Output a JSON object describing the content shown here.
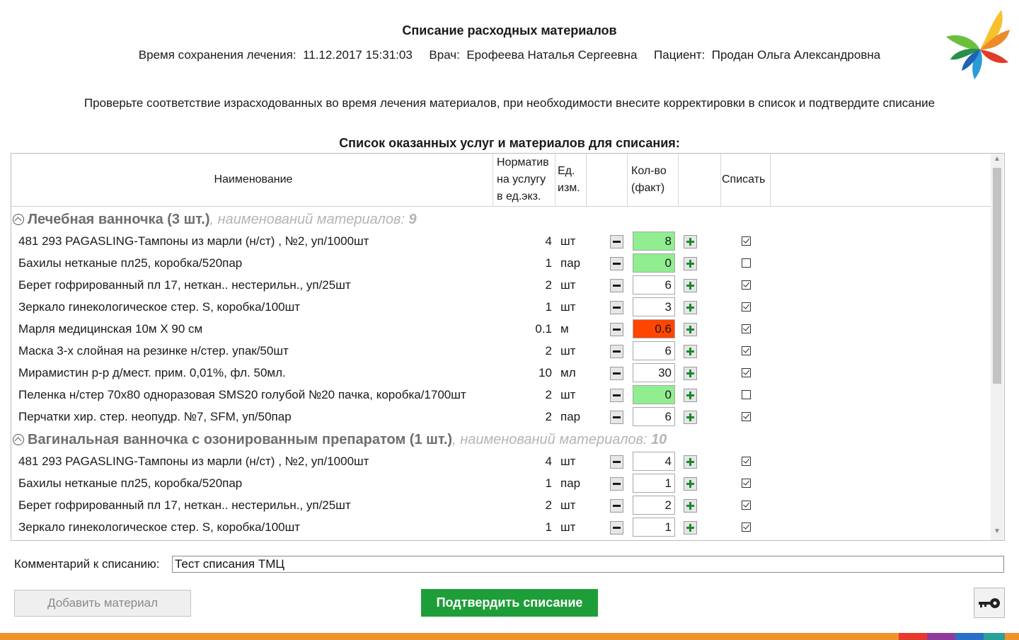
{
  "header": {
    "title": "Списание расходных материалов",
    "save_time_label": "Время сохранения лечения:",
    "save_time_value": "11.12.2017 15:31:03",
    "doctor_label": "Врач:",
    "doctor_value": "Ерофеева Наталья Сергеевна",
    "patient_label": "Пациент:",
    "patient_value": "Продан Ольга Александровна",
    "instruction": "Проверьте соответствие израсходованных во время лечения материалов, при необходимости внесите корректировки в список и подтвердите списание",
    "list_title": "Список оказанных услуг и материалов для списания:"
  },
  "table": {
    "columns": {
      "name": "Наименование",
      "norm_line1": "Норматив",
      "norm_line2": "на услугу",
      "norm_line3": "в ед.экз.",
      "unit_line1": "Ед.",
      "unit_line2": "изм.",
      "qty_line1": "Кол-во",
      "qty_line2": "(факт)",
      "writeoff": "Списать"
    },
    "groups": [
      {
        "title": "Лечебная ванночка (3 шт.)",
        "meta": ", наименований материалов: ",
        "count": "9",
        "rows": [
          {
            "name": "481 293 PAGASLING-Тампоны из марли (н/ст) , №2, уп/1000шт",
            "norm": "4",
            "unit": "шт",
            "qty": "8",
            "state": "green",
            "checked": true
          },
          {
            "name": "Бахилы нетканые пл25, коробка/520пар",
            "norm": "1",
            "unit": "пар",
            "qty": "0",
            "state": "green",
            "checked": false
          },
          {
            "name": "Берет гофрированный пл 17, неткан.. нестерильн., уп/25шт",
            "norm": "2",
            "unit": "шт",
            "qty": "6",
            "state": "normal",
            "checked": true
          },
          {
            "name": "Зеркало гинекологическое стер. S, коробка/100шт",
            "norm": "1",
            "unit": "шт",
            "qty": "3",
            "state": "normal",
            "checked": true
          },
          {
            "name": "Марля медицинская 10м Х 90 см",
            "norm": "0.1",
            "unit": "м",
            "qty": "0.6",
            "state": "red",
            "checked": true
          },
          {
            "name": "Маска 3-х слойная на резинке н/стер. упак/50шт",
            "norm": "2",
            "unit": "шт",
            "qty": "6",
            "state": "normal",
            "checked": true
          },
          {
            "name": "Мирамистин р-р д/мест. прим. 0,01%, фл. 50мл.",
            "norm": "10",
            "unit": "мл",
            "qty": "30",
            "state": "normal",
            "checked": true
          },
          {
            "name": "Пеленка н/стер 70х80 одноразовая SMS20 голубой №20 пачка, коробка/1700шт",
            "norm": "2",
            "unit": "шт",
            "qty": "0",
            "state": "green",
            "checked": false
          },
          {
            "name": "Перчатки хир. стер. неопудр. №7, SFM, уп/50пар",
            "norm": "2",
            "unit": "пар",
            "qty": "6",
            "state": "normal",
            "checked": true
          }
        ]
      },
      {
        "title": "Вагинальная ванночка с озонированным препаратом (1 шт.)",
        "meta": ", наименований материалов: ",
        "count": "10",
        "rows": [
          {
            "name": "481 293 PAGASLING-Тампоны из марли (н/ст) , №2, уп/1000шт",
            "norm": "4",
            "unit": "шт",
            "qty": "4",
            "state": "normal",
            "checked": true
          },
          {
            "name": "Бахилы нетканые пл25, коробка/520пар",
            "norm": "1",
            "unit": "пар",
            "qty": "1",
            "state": "normal",
            "checked": true
          },
          {
            "name": "Берет гофрированный пл 17, неткан.. нестерильн., уп/25шт",
            "norm": "2",
            "unit": "шт",
            "qty": "2",
            "state": "normal",
            "checked": true
          },
          {
            "name": "Зеркало гинекологическое стер. S, коробка/100шт",
            "norm": "1",
            "unit": "шт",
            "qty": "1",
            "state": "normal",
            "checked": true
          }
        ]
      }
    ]
  },
  "comment": {
    "label": "Комментарий к списанию:",
    "value": "Тест списания ТМЦ"
  },
  "buttons": {
    "add_material": "Добавить материал",
    "confirm": "Подтвердить списание",
    "key_icon": "key-icon"
  },
  "colors": {
    "qty_ok": "#90ee90",
    "qty_exceeded": "#ff4500",
    "confirm_button": "#1e9e38",
    "bottom_bar": [
      "#f0932b",
      "#e63a2e",
      "#8e3b9c",
      "#2b6fc7",
      "#2aa198",
      "#f0932b"
    ]
  }
}
